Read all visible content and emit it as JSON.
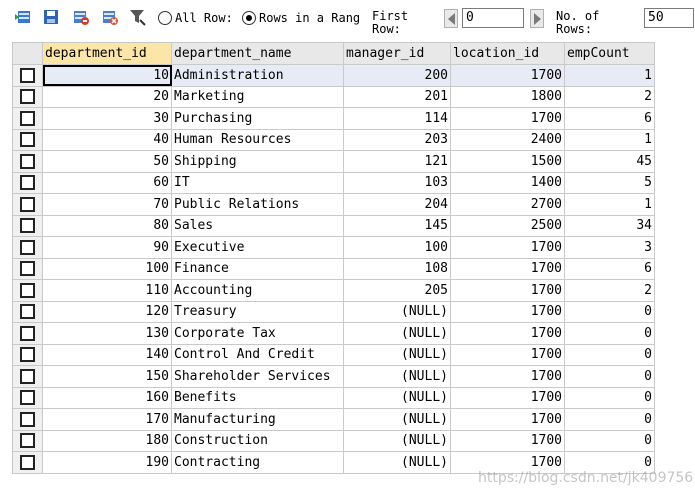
{
  "toolbar": {
    "icons": [
      "insert-row-icon",
      "save-icon",
      "delete-row-icon",
      "cancel-icon",
      "filter-icon"
    ],
    "all_rows_label": "All Row:",
    "rows_range_label": "Rows in a Rang",
    "first_row_label": "First\nRow:",
    "first_row_value": "0",
    "num_rows_label": "No. of\nRows:",
    "num_rows_value": "50",
    "selected_mode": "Rows in a Range"
  },
  "grid": {
    "columns": [
      "department_id",
      "department_name",
      "manager_id",
      "location_id",
      "empCount"
    ],
    "rows": [
      [
        "10",
        "Administration",
        "200",
        "1700",
        "1"
      ],
      [
        "20",
        "Marketing",
        "201",
        "1800",
        "2"
      ],
      [
        "30",
        "Purchasing",
        "114",
        "1700",
        "6"
      ],
      [
        "40",
        "Human Resources",
        "203",
        "2400",
        "1"
      ],
      [
        "50",
        "Shipping",
        "121",
        "1500",
        "45"
      ],
      [
        "60",
        "IT",
        "103",
        "1400",
        "5"
      ],
      [
        "70",
        "Public Relations",
        "204",
        "2700",
        "1"
      ],
      [
        "80",
        "Sales",
        "145",
        "2500",
        "34"
      ],
      [
        "90",
        "Executive",
        "100",
        "1700",
        "3"
      ],
      [
        "100",
        "Finance",
        "108",
        "1700",
        "6"
      ],
      [
        "110",
        "Accounting",
        "205",
        "1700",
        "2"
      ],
      [
        "120",
        "Treasury",
        "(NULL)",
        "1700",
        "0"
      ],
      [
        "130",
        "Corporate Tax",
        "(NULL)",
        "1700",
        "0"
      ],
      [
        "140",
        "Control And Credit",
        "(NULL)",
        "1700",
        "0"
      ],
      [
        "150",
        "Shareholder Services",
        "(NULL)",
        "1700",
        "0"
      ],
      [
        "160",
        "Benefits",
        "(NULL)",
        "1700",
        "0"
      ],
      [
        "170",
        "Manufacturing",
        "(NULL)",
        "1700",
        "0"
      ],
      [
        "180",
        "Construction",
        "(NULL)",
        "1700",
        "0"
      ],
      [
        "190",
        "Contracting",
        "(NULL)",
        "1700",
        "0"
      ]
    ]
  },
  "watermark": "https://blog.csdn.net/jk409756",
  "colors": {
    "header_bg": "#e8e8e8",
    "selected_header_bg": "#fbe6a8",
    "selected_row_bg": "#e6ebf5"
  }
}
